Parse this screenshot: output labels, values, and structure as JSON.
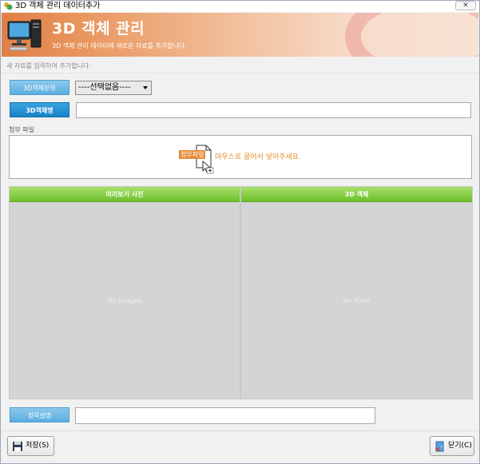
{
  "window": {
    "title": "3D 객체 관리 데이터추가",
    "close_label": "✕"
  },
  "header": {
    "title": "3D 객체 관리",
    "subtitle": "3D 객체 관리 데이터에 새로운 자료를 추가합니다."
  },
  "hint": "새 자료를 입력하여 추가합니다.",
  "form": {
    "category_label": "3D객체분류",
    "category_value": "----선택없음----",
    "name_label": "3D객체명",
    "name_value": "",
    "attach_label": "첨부 파일",
    "attach_badge": "첨부파일",
    "attach_hint": "마우스로 끌어서 넣어주세요.",
    "desc_label": "항목설명",
    "desc_value": ""
  },
  "panels": {
    "preview_title": "미리보기 사진",
    "preview_placeholder": "No Images",
    "object_title": "3D 객체",
    "object_placeholder": "No Xaml"
  },
  "buttons": {
    "save": "저장(S)",
    "close": "닫기(C)"
  },
  "colors": {
    "header_gradient_start": "#e07f45",
    "label_blue": "#3a9fd8",
    "panel_header_green": "#6cc02c",
    "hint_orange": "#e0912b"
  },
  "icons": [
    "app-icon",
    "computer-icon",
    "file-drop-icon",
    "save-icon",
    "close-door-icon"
  ]
}
